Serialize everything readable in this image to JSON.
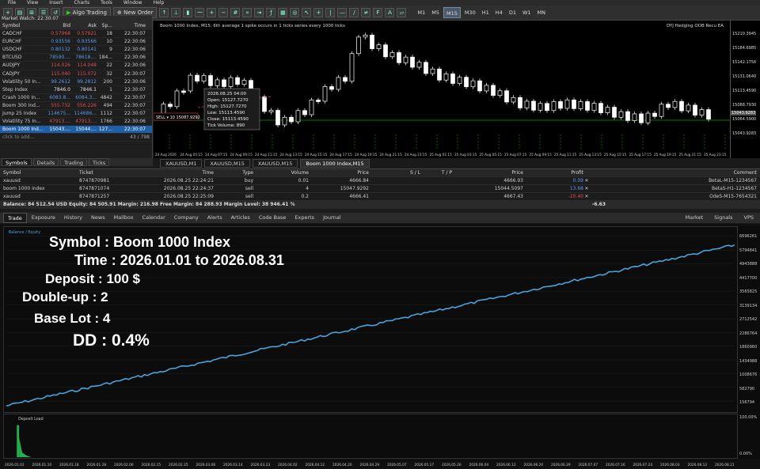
{
  "menu": [
    "File",
    "View",
    "Insert",
    "Charts",
    "Tools",
    "Window",
    "Help"
  ],
  "toolbar": {
    "algo_trading": "Algo Trading",
    "new_order": "New Order",
    "timeframes": [
      "M1",
      "M5",
      "M15",
      "M30",
      "H1",
      "H4",
      "D1",
      "W1",
      "MN"
    ],
    "active_tf": "M15"
  },
  "market_watch": {
    "title": "Market Watch: 22:30:07",
    "headers": [
      "Symbol",
      "Bid",
      "Ask",
      "Sp...",
      "Time"
    ],
    "rows": [
      {
        "symbol": "CADCHF",
        "bid": "0.57968",
        "ask": "0.57921",
        "spread": "18",
        "time": "22:30:07",
        "color": "red"
      },
      {
        "symbol": "EURCHF",
        "bid": "0.93556",
        "ask": "0.93566",
        "spread": "10",
        "time": "22:30:06",
        "color": "blue"
      },
      {
        "symbol": "USDCHF",
        "bid": "0.80132",
        "ask": "0.80141",
        "spread": "9",
        "time": "22:30:06",
        "color": "blue"
      },
      {
        "symbol": "BTCUSD",
        "bid": "78590....",
        "ask": "78618....",
        "spread": "184...",
        "time": "22:30:06",
        "color": "blue"
      },
      {
        "symbol": "AUDJPY",
        "bid": "114.026",
        "ask": "114.048",
        "spread": "22",
        "time": "22:30:06",
        "color": "red"
      },
      {
        "symbol": "CADJPY",
        "bid": "115.040",
        "ask": "115.072",
        "spread": "32",
        "time": "22:30:07",
        "color": "red"
      },
      {
        "symbol": "Volatility 50 In...",
        "bid": "99.2612",
        "ask": "99.2812",
        "spread": "200",
        "time": "22:30:06",
        "color": "blue"
      },
      {
        "symbol": "Step Index",
        "bid": "7846.0",
        "ask": "7846.1",
        "spread": "1",
        "time": "22:30:07",
        "color": "white"
      },
      {
        "symbol": "Crash 1000 In...",
        "bid": "6083.8...",
        "ask": "6084.3...",
        "spread": "4842",
        "time": "22:30:07",
        "color": "blue"
      },
      {
        "symbol": "Boom 300 Ind...",
        "bid": "555.732",
        "ask": "556.226",
        "spread": "494",
        "time": "22:30:07",
        "color": "red"
      },
      {
        "symbol": "Jump 25 Index",
        "bid": "114675...",
        "ask": "114686...",
        "spread": "1112",
        "time": "22:30:07",
        "color": "blue"
      },
      {
        "symbol": "Volatility 75 In...",
        "bid": "47913....",
        "ask": "47913....",
        "spread": "1766",
        "time": "22:30:06",
        "color": "red"
      },
      {
        "symbol": "Boom 1000 Ind...",
        "bid": "15043....",
        "ask": "15044....",
        "spread": "127...",
        "time": "22:30:07",
        "color": "sel"
      }
    ],
    "footer": "click to add...",
    "count": "43 / 798",
    "tabs": [
      "Symbols",
      "Details",
      "Trading",
      "Ticks"
    ]
  },
  "chart": {
    "header": "Boom 1000 Index, M15:  6th average 1 spike occurs in 1 ticks series every 1000 ticks",
    "header_right": "DYJ Hedging OOB Recu EA",
    "tooltip": [
      "2026.08.25 04:00",
      "Open: 15127.7270",
      "High: 15127.7270",
      "Low: 15113.4590",
      "Close: 15113.4590",
      "Tick Volume: 890"
    ],
    "sell_label": "SELL ▾ 10 15087.9292",
    "price_labels": [
      "15210.3945",
      "15184.6985",
      "15142.1756",
      "15131.0640",
      "15113.4590",
      "15088.7930",
      "15064.5900",
      "15043.9283"
    ],
    "current_price": "15043.9283",
    "date_labels": [
      "24 Aug 2026",
      "24 Aug 05:15",
      "24 Aug 07:15",
      "24 Aug 09:15",
      "24 Aug 11:15",
      "24 Aug 13:15",
      "24 Aug 15:15",
      "24 Aug 17:15",
      "24 Aug 19:15",
      "24 Aug 21:15",
      "24 Aug 23:15",
      "25 Aug 01:15",
      "25 Aug 03:15",
      "25 Aug 05:15",
      "25 Aug 07:15",
      "25 Aug 09:15",
      "25 Aug 11:15",
      "25 Aug 13:15",
      "25 Aug 15:15",
      "25 Aug 17:15",
      "25 Aug 19:15",
      "25 Aug 21:15",
      "25 Aug 23:15"
    ],
    "tabs": [
      "XAUUSD,M1",
      "XAUUSD,M15",
      "XAUUSD,M15",
      "Boom 1000 Index,M15"
    ],
    "active_tab": 3
  },
  "trade": {
    "headers": [
      "Symbol",
      "Ticket",
      "Time",
      "Type",
      "Volume",
      "Price",
      "S / L",
      "T / P",
      "Price",
      "Profit",
      "",
      "Comment"
    ],
    "rows": [
      {
        "symbol": "xauusd",
        "ticket": "8747870981",
        "time": "2026.08.25 22:24:21",
        "type": "buy",
        "volume": "0.01",
        "price": "4666.84",
        "sl": "",
        "tp": "",
        "price2": "4666.93",
        "profit": "0.09",
        "comment": "BetaL-M15-1234567",
        "pcolor": "blue"
      },
      {
        "symbol": "boom 1000 index",
        "ticket": "8747871074",
        "time": "2026.08.25 22:24:37",
        "type": "sell",
        "volume": "4",
        "price": "15047.9292",
        "sl": "",
        "tp": "",
        "price2": "15044.5097",
        "profit": "13.68",
        "comment": "BetaS-H1-1234567",
        "pcolor": "blue"
      },
      {
        "symbol": "xauusd",
        "ticket": "8747871257",
        "time": "2026.08.25 22:25:09",
        "type": "sell",
        "volume": "0.2",
        "price": "4666.41",
        "sl": "",
        "tp": "",
        "price2": "4667.43",
        "profit": "-20.40",
        "comment": "OdeS-M15-7654321",
        "pcolor": "red"
      }
    ],
    "balance_line": "Balance: 84 512.54 USD  Equity: 84 505.91  Margin: 216.98  Free Margin: 84 288.93  Margin Level: 38 946.41 %",
    "balance_total": "-6.63"
  },
  "bottom_tabs": [
    "Trade",
    "Exposure",
    "History",
    "News",
    "Mailbox",
    "Calendar",
    "Company",
    "Alerts",
    "Articles",
    "Code Base",
    "Experts",
    "Journal"
  ],
  "bottom_right": [
    "Market",
    "Signals",
    "VPS"
  ],
  "report": {
    "legend": "Balance / Equity",
    "overlay": [
      {
        "label": "Symbol : Boom 1000 Index"
      },
      {
        "label": "Time : 2026.01.01 to 2026.08.31"
      },
      {
        "label": "Deposit : 100 $"
      },
      {
        "label": "Double-up : 2"
      },
      {
        "label": "Base Lot : 4"
      },
      {
        "label": "DD : 0.4%"
      }
    ],
    "y_labels": [
      "6696261",
      "5794841",
      "4943888",
      "4417700",
      "3565825",
      "3139134",
      "2712542",
      "2286764",
      "1860960",
      "1434988",
      "1008676",
      "582790",
      "156794"
    ],
    "load_title": "Deposit Load",
    "load_labels": [
      "100.00%",
      "0.00%"
    ],
    "x_labels": [
      "2026.01.01",
      "2026.01.10",
      "2026.01.18",
      "2026.01.28",
      "2026.02.06",
      "2026.02.15",
      "2026.02.25",
      "2026.03.06",
      "2026.03.14",
      "2026.03.23",
      "2026.04.02",
      "2026.04.12",
      "2026.04.20",
      "2026.04.29",
      "2026.05.07",
      "2026.05.17",
      "2026.05.26",
      "2026.06.04",
      "2026.06.12",
      "2026.06.20",
      "2026.06.29",
      "2026.07.07",
      "2026.07.16",
      "2026.07.24",
      "2026.08.03",
      "2026.08.12",
      "2026.08.21"
    ]
  },
  "colors": {
    "bull": "#ffffff",
    "bear": "#ffffff",
    "grid": "#00a000",
    "curve": "#4aa3df",
    "load": "#22b14c"
  }
}
